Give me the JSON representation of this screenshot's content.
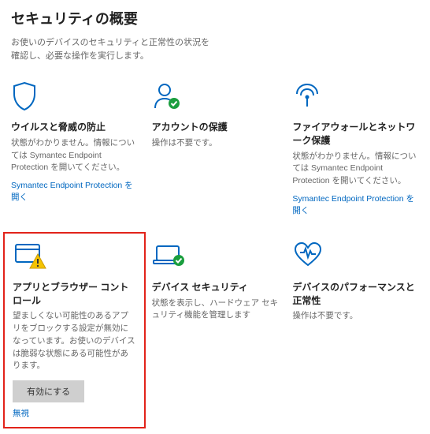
{
  "page": {
    "title": "セキュリティの概要",
    "subtitle": "お使いのデバイスのセキュリティと正常性の状況を確認し、必要な操作を実行します。"
  },
  "cards": {
    "virus": {
      "title": "ウイルスと脅威の防止",
      "desc": "状態がわかりません。情報については Symantec Endpoint Protection を開いてください。",
      "link": "Symantec Endpoint Protection を開く"
    },
    "account": {
      "title": "アカウントの保護",
      "desc": "操作は不要です。"
    },
    "firewall": {
      "title": "ファイアウォールとネットワーク保護",
      "desc": "状態がわかりません。情報については Symantec Endpoint Protection を開いてください。",
      "link": "Symantec Endpoint Protection を開く"
    },
    "appbrowser": {
      "title": "アプリとブラウザー コントロール",
      "desc": "望ましくない可能性のあるアプリをブロックする設定が無効になっています。お使いのデバイスは脆弱な状態にある可能性があります。",
      "enable": "有効にする",
      "dismiss": "無視"
    },
    "device": {
      "title": "デバイス セキュリティ",
      "desc": "状態を表示し、ハードウェア セキュリティ機能を管理します"
    },
    "health": {
      "title": "デバイスのパフォーマンスと正常性",
      "desc": "操作は不要です。"
    }
  },
  "colors": {
    "accent": "#0067c0",
    "highlight_border": "#e2231a",
    "ok_badge": "#1a9e3e",
    "warn_badge": "#f5c400"
  }
}
